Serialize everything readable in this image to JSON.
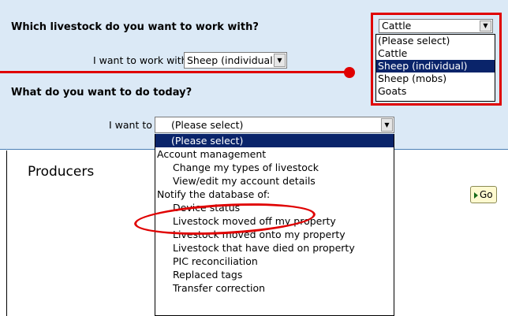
{
  "livestock_section": {
    "heading": "Which livestock do you want to work with?",
    "row_label": "I want to work with",
    "selected_value": "Sheep (individual)"
  },
  "task_section": {
    "heading": "What do you want to do today?",
    "row_label": "I want to",
    "selected_value": "(Please select)"
  },
  "callout_dropdown": {
    "selected_value": "Cattle",
    "options": [
      "(Please select)",
      "Cattle",
      "Sheep (individual)",
      "Sheep (mobs)",
      "Goats"
    ],
    "highlighted_option": "Sheep (individual)"
  },
  "task_dropdown_list": {
    "options": [
      {
        "label": "(Please select)",
        "kind": "selected"
      },
      {
        "label": "Account management",
        "kind": "group"
      },
      {
        "label": "Change my types of livestock",
        "kind": "child"
      },
      {
        "label": "View/edit my account details",
        "kind": "child"
      },
      {
        "label": "Notify the database of:",
        "kind": "group"
      },
      {
        "label": "Device status",
        "kind": "child"
      },
      {
        "label": "Livestock moved off my property",
        "kind": "child"
      },
      {
        "label": "Livestock moved onto my property",
        "kind": "child"
      },
      {
        "label": "Livestock that have died on property",
        "kind": "child"
      },
      {
        "label": "PIC reconciliation",
        "kind": "child"
      },
      {
        "label": "Replaced tags",
        "kind": "child"
      },
      {
        "label": "Transfer correction",
        "kind": "child"
      }
    ],
    "circled_option": "Device status"
  },
  "producers_label": "Producers",
  "go_button_label": "Go",
  "colors": {
    "panel_background": "#dbe9f6",
    "annotation_red": "#e00000",
    "selection_highlight": "#0a246a",
    "go_button_fill": "#fffad0"
  }
}
